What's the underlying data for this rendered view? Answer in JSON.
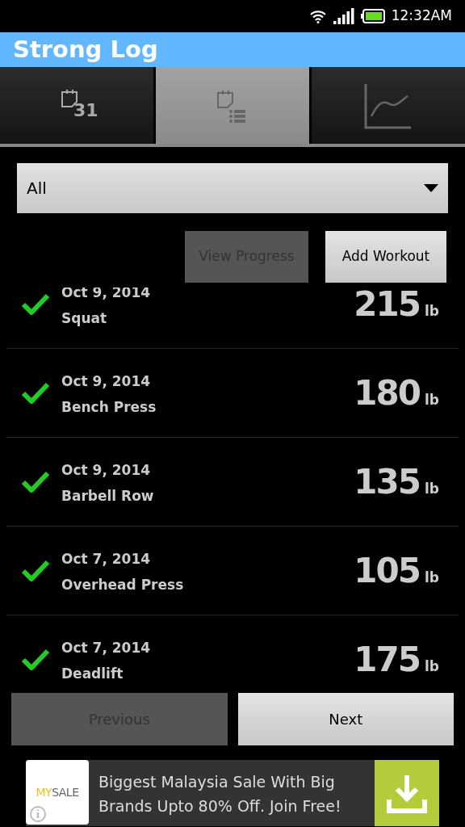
{
  "status_bar": {
    "time": "12:32AM"
  },
  "app_bar": {
    "title": "Strong Log"
  },
  "tabs": [
    {
      "kind": "calendar",
      "label": "31",
      "selected": false
    },
    {
      "kind": "list",
      "selected": true
    },
    {
      "kind": "chart",
      "selected": false
    }
  ],
  "filter": {
    "value": "All"
  },
  "actions": [
    {
      "label": "View Progress",
      "disabled": true
    },
    {
      "label": "Add Workout",
      "disabled": false
    }
  ],
  "workouts": [
    {
      "date": "Oct 9, 2014",
      "exercise": "Squat",
      "weight": "215",
      "unit": "lb",
      "done": true
    },
    {
      "date": "Oct 9, 2014",
      "exercise": "Bench Press",
      "weight": "180",
      "unit": "lb",
      "done": true
    },
    {
      "date": "Oct 9, 2014",
      "exercise": "Barbell Row",
      "weight": "135",
      "unit": "lb",
      "done": true
    },
    {
      "date": "Oct 7, 2014",
      "exercise": "Overhead Press",
      "weight": "105",
      "unit": "lb",
      "done": true
    },
    {
      "date": "Oct 7, 2014",
      "exercise": "Deadlift",
      "weight": "175",
      "unit": "lb",
      "done": true
    }
  ],
  "pager": [
    {
      "label": "Previous",
      "disabled": true
    },
    {
      "label": "Next",
      "disabled": false
    }
  ],
  "ad": {
    "logo_parts": [
      "MY",
      "SALE"
    ],
    "text": "Biggest Malaysia Sale With Big Brands Upto 80% Off. Join Free!"
  }
}
